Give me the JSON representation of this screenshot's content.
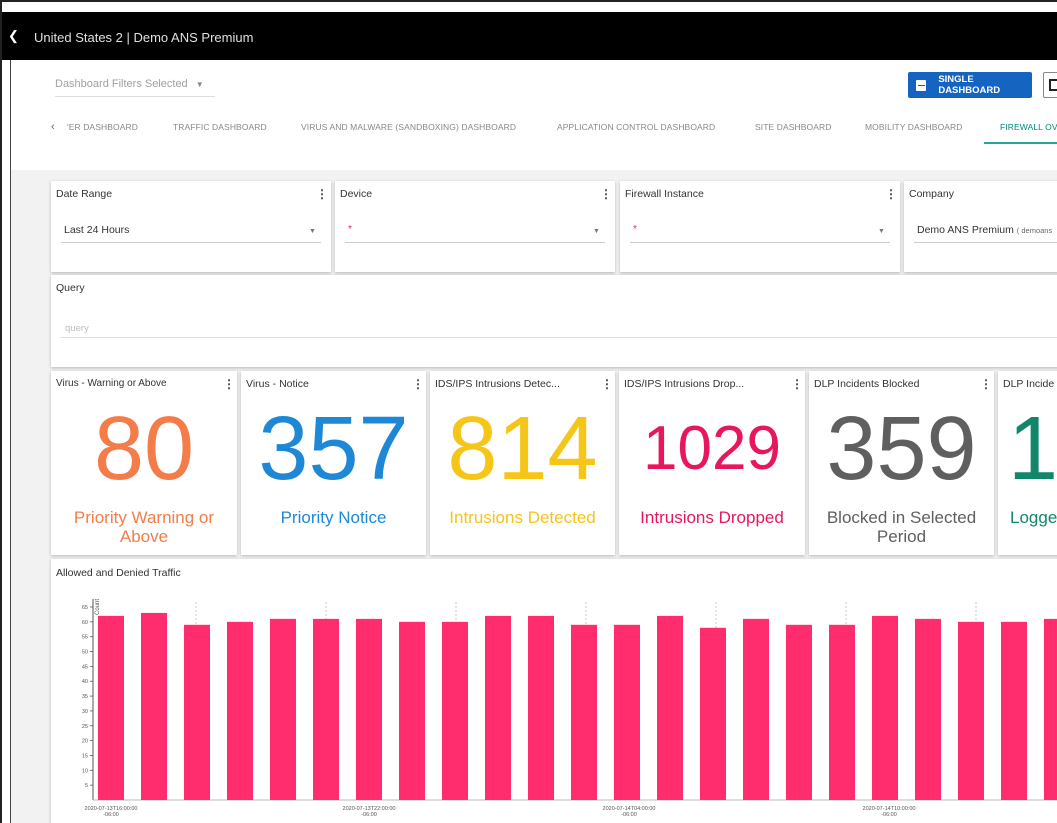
{
  "app": {
    "title": "United States 2 | Demo ANS Premium"
  },
  "header": {
    "filter_label": "Dashboard Filters Selected",
    "single_dashboard_label": "SINGLE DASHBOARD"
  },
  "tabs": [
    {
      "label": "'ER DASHBOARD"
    },
    {
      "label": "TRAFFIC DASHBOARD"
    },
    {
      "label": "VIRUS AND MALWARE (SANDBOXING) DASHBOARD"
    },
    {
      "label": "APPLICATION CONTROL DASHBOARD"
    },
    {
      "label": "SITE DASHBOARD"
    },
    {
      "label": "MOBILITY DASHBOARD"
    },
    {
      "label": "FIREWALL OV"
    }
  ],
  "filters": {
    "date_range": {
      "title": "Date Range",
      "value": "Last 24 Hours"
    },
    "device": {
      "title": "Device",
      "value": "*"
    },
    "firewall_instance": {
      "title": "Firewall Instance",
      "value": "*"
    },
    "company": {
      "title": "Company",
      "value": "Demo ANS Premium",
      "sub": "( demoans"
    }
  },
  "query": {
    "title": "Query",
    "placeholder": "query"
  },
  "stats": [
    {
      "title": "Virus - Warning or Above",
      "value": "80",
      "label": "Priority Warning or Above",
      "color": "#f47c48"
    },
    {
      "title": "Virus - Notice",
      "value": "357",
      "label": "Priority Notice",
      "color": "#1e88d6"
    },
    {
      "title": "IDS/IPS Intrusions Detec...",
      "value": "814",
      "label": "Intrusions Detected",
      "color": "#f5c518"
    },
    {
      "title": "IDS/IPS Intrusions Drop...",
      "value": "1029",
      "label": "Intrusions Dropped",
      "color": "#e8175d"
    },
    {
      "title": "DLP Incidents Blocked",
      "value": "359",
      "label": "Blocked in Selected Period",
      "color": "#5f5f5f"
    },
    {
      "title": "DLP Incide",
      "value": "1:",
      "label": "Logge",
      "color": "#12866b"
    }
  ],
  "chart_data": {
    "type": "bar",
    "title": "Allowed and Denied Traffic",
    "ylabel": "Count",
    "ylim": [
      0,
      65
    ],
    "yticks": [
      "5",
      "10",
      "15",
      "20",
      "25",
      "30",
      "35",
      "40",
      "45",
      "50",
      "55",
      "60",
      "65"
    ],
    "xtick_labels": [
      [
        "2020-07-13T16:00:00",
        "-06:00"
      ],
      [
        "2020-07-13T22:00:00",
        "-06:00"
      ],
      [
        "2020-07-14T04:00:00",
        "-06:00"
      ],
      [
        "2020-07-14T10:00:00",
        "-06:00"
      ]
    ],
    "color": "#ff2d6e",
    "values": [
      62,
      63,
      59,
      60,
      61,
      61,
      61,
      60,
      60,
      62,
      62,
      59,
      59,
      62,
      58,
      61,
      59,
      59,
      62,
      61,
      60,
      60,
      61
    ]
  }
}
